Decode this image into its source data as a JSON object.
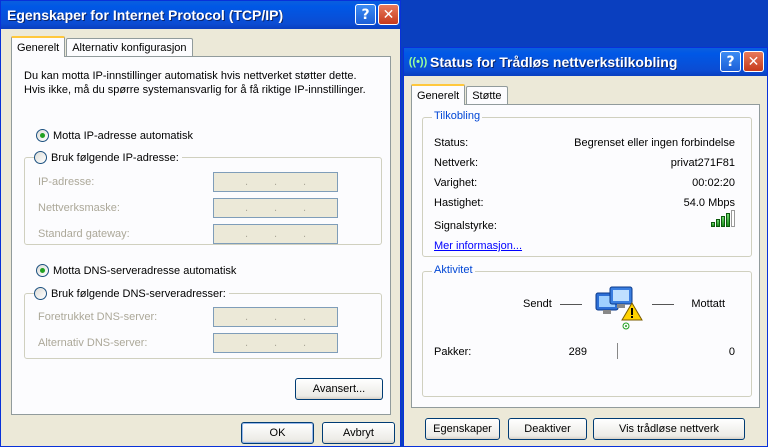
{
  "tcpip_dialog": {
    "title": "Egenskaper for Internet Protocol (TCP/IP)",
    "tabs": [
      "Generelt",
      "Alternativ konfigurasjon"
    ],
    "description": "Du kan motta IP-innstillinger automatisk hvis nettverket støtter dette. Hvis ikke, må du spørre systemansvarlig for å få riktige IP-innstillinger.",
    "ip_auto_label": "Motta IP-adresse automatisk",
    "ip_manual_label": "Bruk følgende IP-adresse:",
    "ip_fields": {
      "ip_address": "IP-adresse:",
      "subnet_mask": "Nettverksmaske:",
      "default_gateway": "Standard gateway:"
    },
    "dns_auto_label": "Motta DNS-serveradresse automatisk",
    "dns_manual_label": "Bruk følgende DNS-serveradresser:",
    "dns_fields": {
      "preferred": "Foretrukket DNS-server:",
      "alternate": "Alternativ DNS-server:"
    },
    "advanced_label": "Avansert...",
    "ok_label": "OK",
    "cancel_label": "Avbryt",
    "help_glyph": "?",
    "close_glyph": "✕"
  },
  "status_dialog": {
    "title": "Status for Trådløs nettverkstilkobling",
    "tabs": [
      "Generelt",
      "Støtte"
    ],
    "connection_section": "Tilkobling",
    "rows": {
      "status_key": "Status:",
      "status_val": "Begrenset eller ingen forbindelse",
      "network_key": "Nettverk:",
      "network_val": "privat271F81",
      "duration_key": "Varighet:",
      "duration_val": "00:02:20",
      "speed_key": "Hastighet:",
      "speed_val": "54.0 Mbps",
      "signal_key": "Signalstyrke:"
    },
    "signal_bars": 4,
    "more_info_link": "Mer informasjon...",
    "activity_section": "Aktivitet",
    "sent_label": "Sendt",
    "received_label": "Mottatt",
    "packets_label": "Pakker:",
    "packets_sent": "289",
    "packets_received": "0",
    "buttons": {
      "properties": "Egenskaper",
      "disable": "Deaktiver",
      "view_networks": "Vis trådløse nettverk"
    },
    "help_glyph": "?",
    "close_glyph": "✕",
    "title_icon": "((•))"
  },
  "colors": {
    "desktop": "#0a3fbf",
    "section_label": "#0046d5",
    "radio_dot": "#21a121"
  }
}
